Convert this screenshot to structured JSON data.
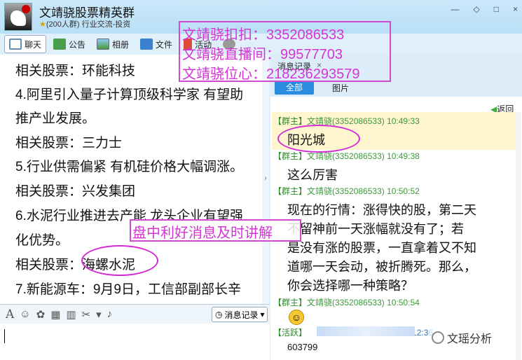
{
  "window": {
    "group_name": "文靖骁股票精英群",
    "group_info": "(200人群) 行业交流-投资",
    "controls": [
      "—",
      "◇",
      "□",
      "×"
    ]
  },
  "toolbar": {
    "chat": "聊天",
    "announcement": "公告",
    "album": "相册",
    "files": "文件",
    "activity": "活动"
  },
  "left_messages": [
    "相关股票：环能科技",
    "4.阿里引入量子计算顶级科学家 有望助",
    "推产业发展。",
    "相关股票：三力士",
    "5.行业供需偏紧 有机硅价格大幅调涨。",
    "相关股票：兴发集团",
    "6.水泥行业推进去产能 龙头企业有望强",
    "化优势。",
    "相关股票：海螺水泥",
    "7.新能源车：9月9日，工信部副部长辛"
  ],
  "input_toolbar": {
    "history_label": "消息记录"
  },
  "history_panel": {
    "title": "消息记录",
    "close": "×",
    "tab_all": "全部",
    "tab_images": "图片",
    "back": "返回"
  },
  "history_messages": [
    {
      "role": "【群主】",
      "meta": "文靖骁(3352086533) 10:49:33",
      "text": [
        "阳光城"
      ]
    },
    {
      "role": "【群主】",
      "meta": "文靖骁(3352086533) 10:49:38",
      "text": [
        "这么厉害"
      ]
    },
    {
      "role": "【群主】",
      "meta": "文靖骁(3352086533) 10:50:52",
      "text": [
        "现在的行情：涨得快的股，第二天",
        "不留神前一天涨幅就没有了；若",
        "是没有涨的股票，一直拿着又不知",
        "道哪一天会动，被折腾死。那么，",
        "你会选择哪一种策略？"
      ]
    },
    {
      "role": "【群主】",
      "meta": "文靖骁(3352086533) 10:50:54",
      "text": []
    },
    {
      "role": "【活跃】",
      "meta": "12:36",
      "text": [
        "603799"
      ]
    }
  ],
  "overlay": {
    "lines": [
      "文靖骁扣扣：3352086533",
      "文靖骁直播间：99577703",
      "文靖骁位心：218236293579"
    ],
    "news": "盘中利好消息及时讲解"
  },
  "watermark": "文瑶分析",
  "colors": {
    "overlay": "#d434d4",
    "accent_tab": "#2b8bde",
    "meta_green": "#3b9a3b"
  }
}
